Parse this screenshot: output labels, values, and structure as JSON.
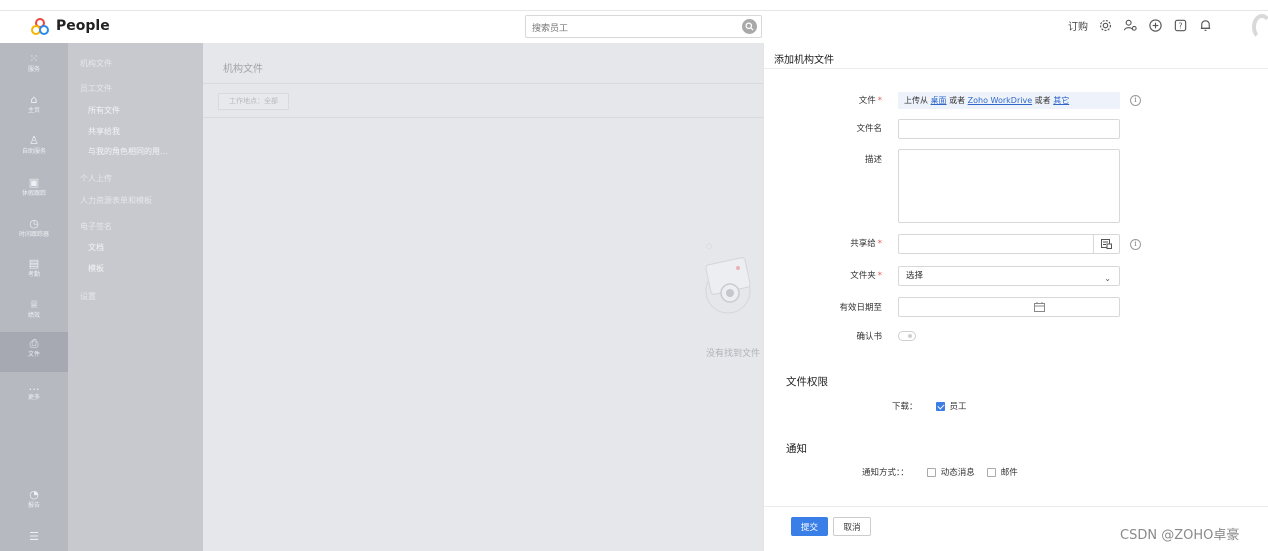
{
  "app": {
    "title": "People",
    "logo_icon": "people-logo-icon"
  },
  "search": {
    "placeholder": "搜索员工"
  },
  "topbar": {
    "subscribe_label": "订购"
  },
  "leftnav": {
    "items": [
      {
        "label": "服务",
        "icon": "grid-icon"
      },
      {
        "label": "主页",
        "icon": "home-icon"
      },
      {
        "label": "自助服务",
        "icon": "person-icon"
      },
      {
        "label": "休假跟踪",
        "icon": "calendar-icon"
      },
      {
        "label": "时间跟踪器",
        "icon": "clock-icon"
      },
      {
        "label": "考勤",
        "icon": "attendance-icon"
      },
      {
        "label": "绩效",
        "icon": "trophy-icon"
      },
      {
        "label": "文件",
        "icon": "files-icon"
      },
      {
        "label": "更多",
        "icon": "more-icon"
      },
      {
        "label": "报告",
        "icon": "report-icon"
      }
    ]
  },
  "subnav": {
    "items": [
      {
        "label": "机构文件",
        "type": "group"
      },
      {
        "label": "员工文件",
        "type": "group"
      },
      {
        "label": "所有文件",
        "type": "child"
      },
      {
        "label": "共享给我",
        "type": "child"
      },
      {
        "label": "与我的角色相同的用...",
        "type": "child"
      },
      {
        "label": "个人上传",
        "type": "group"
      },
      {
        "label": "人力资源表单和模板",
        "type": "group"
      },
      {
        "label": "电子签名",
        "type": "group"
      },
      {
        "label": "文档",
        "type": "child"
      },
      {
        "label": "模板",
        "type": "child"
      },
      {
        "label": "设置",
        "type": "group"
      }
    ]
  },
  "content": {
    "title": "机构文件",
    "filter_label": "工作地点：全部",
    "empty_text": "没有找到文件"
  },
  "form": {
    "title": "添加机构文件",
    "fields": {
      "file": {
        "label": "文件",
        "upload_prefix": "上传从",
        "link_desktop": "桌面",
        "or1": "或者",
        "link_workdrive": "Zoho WorkDrive",
        "or2": "或者",
        "link_other": "其它"
      },
      "filename": {
        "label": "文件名",
        "value": ""
      },
      "description": {
        "label": "描述",
        "value": ""
      },
      "share_to": {
        "label": "共享给",
        "value": ""
      },
      "folder": {
        "label": "文件夹",
        "selected": "选择"
      },
      "valid_until": {
        "label": "有效日期至",
        "value": ""
      },
      "acknowledgement": {
        "label": "确认书",
        "enabled": false
      }
    },
    "permissions": {
      "title": "文件权限",
      "download_label": "下载：",
      "download_option": "员工",
      "download_checked": true
    },
    "notify": {
      "title": "通知",
      "method_label": "通知方式：：",
      "options": [
        {
          "label": "动态消息",
          "checked": false
        },
        {
          "label": "邮件",
          "checked": false
        }
      ]
    },
    "submit_label": "提交",
    "cancel_label": "取消"
  },
  "watermark": "CSDN @ZOHO卓豪"
}
